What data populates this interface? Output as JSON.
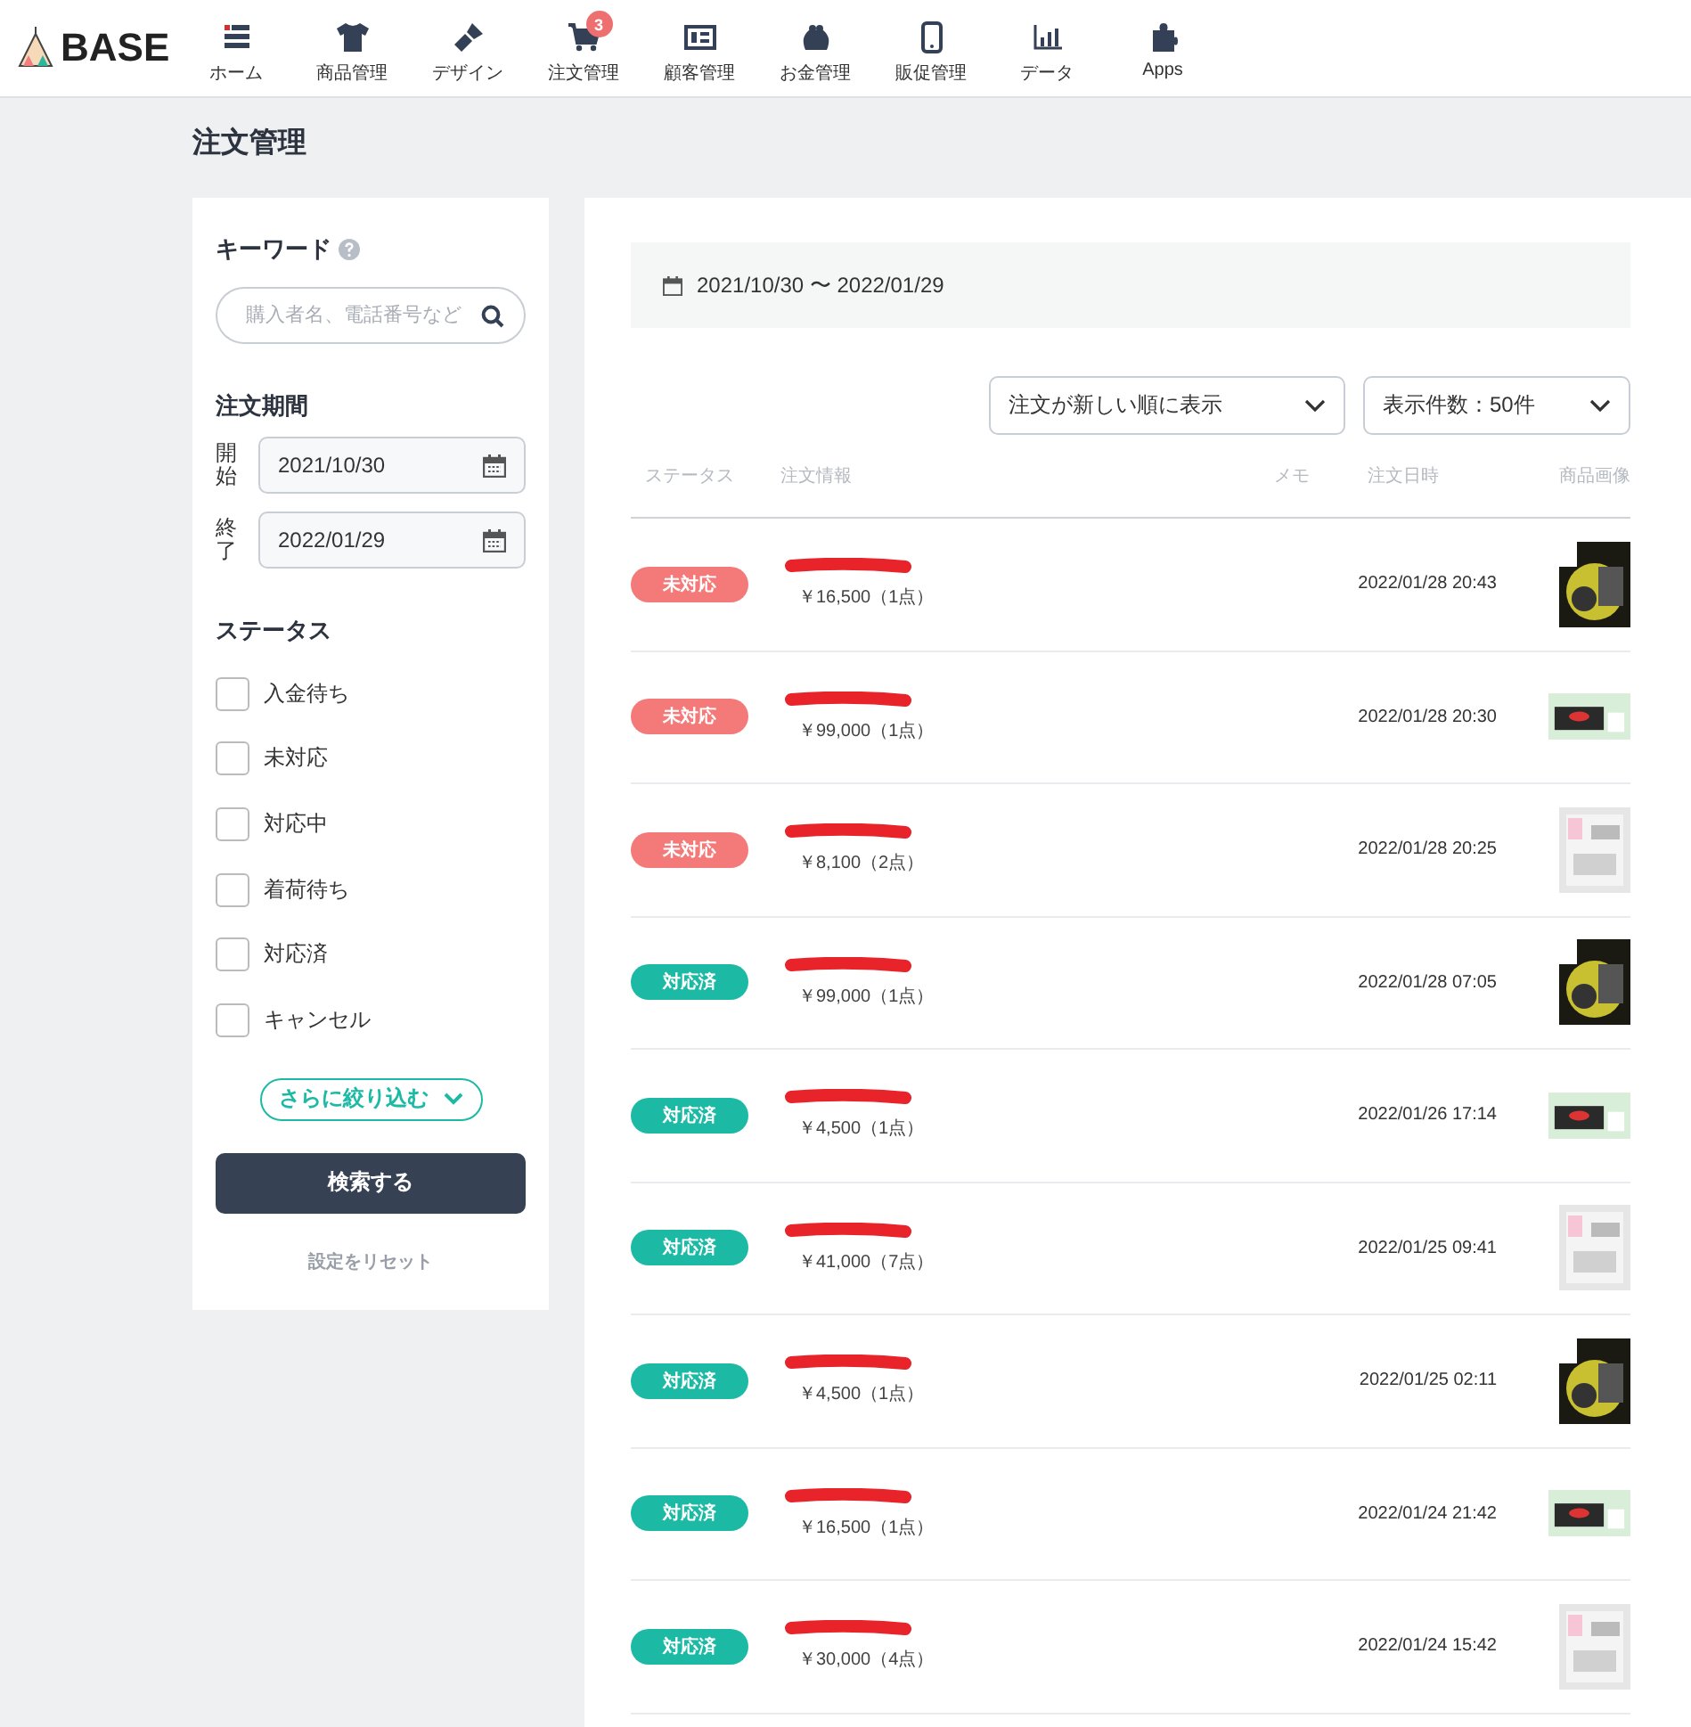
{
  "header": {
    "logo": "BASE",
    "nav": [
      {
        "label": "ホーム"
      },
      {
        "label": "商品管理"
      },
      {
        "label": "デザイン"
      },
      {
        "label": "注文管理",
        "badge": "3"
      },
      {
        "label": "顧客管理"
      },
      {
        "label": "お金管理"
      },
      {
        "label": "販促管理"
      },
      {
        "label": "データ"
      },
      {
        "label": "Apps"
      }
    ]
  },
  "page_title": "注文管理",
  "filters": {
    "keyword_label": "キーワード",
    "keyword": {
      "placeholder": "購入者名、電話番号など"
    },
    "period_label": "注文期間",
    "start_label": "開始",
    "start": "2021/10/30",
    "end_label": "終了",
    "end": "2022/01/29",
    "status_label": "ステータス",
    "statuses": [
      {
        "label": "入金待ち",
        "checked": false
      },
      {
        "label": "未対応",
        "checked": false
      },
      {
        "label": "対応中",
        "checked": false
      },
      {
        "label": "着荷待ち",
        "checked": false
      },
      {
        "label": "対応済",
        "checked": false
      },
      {
        "label": "キャンセル",
        "checked": false
      }
    ],
    "more_button": "さらに絞り込む",
    "search_button": "検索する",
    "reset_link": "設定をリセット"
  },
  "orders": {
    "range": "2021/10/30 〜 2022/01/29",
    "sort_select": "注文が新しい順に表示",
    "count_select": "表示件数：50件",
    "columns": [
      "ステータス",
      "注文情報",
      "メモ",
      "注文日時",
      "商品画像"
    ],
    "rows": [
      {
        "status": "未対応",
        "color": "#f47a7a",
        "amount": "￥16,500（1点）",
        "date": "2022/01/28 20:43"
      },
      {
        "status": "未対応",
        "color": "#f47a7a",
        "amount": "￥99,000（1点）",
        "date": "2022/01/28 20:30"
      },
      {
        "status": "未対応",
        "color": "#f47a7a",
        "amount": "￥8,100（2点）",
        "date": "2022/01/28 20:25"
      },
      {
        "status": "対応済",
        "color": "#1cbaa5",
        "amount": "￥99,000（1点）",
        "date": "2022/01/28 07:05"
      },
      {
        "status": "対応済",
        "color": "#1cbaa5",
        "amount": "￥4,500（1点）",
        "date": "2022/01/26 17:14"
      },
      {
        "status": "対応済",
        "color": "#1cbaa5",
        "amount": "￥41,000（7点）",
        "date": "2022/01/25 09:41"
      },
      {
        "status": "対応済",
        "color": "#1cbaa5",
        "amount": "￥4,500（1点）",
        "date": "2022/01/25 02:11"
      },
      {
        "status": "対応済",
        "color": "#1cbaa5",
        "amount": "￥16,500（1点）",
        "date": "2022/01/24 21:42"
      },
      {
        "status": "対応済",
        "color": "#1cbaa5",
        "amount": "￥30,000（4点）",
        "date": "2022/01/24 15:42"
      }
    ]
  }
}
